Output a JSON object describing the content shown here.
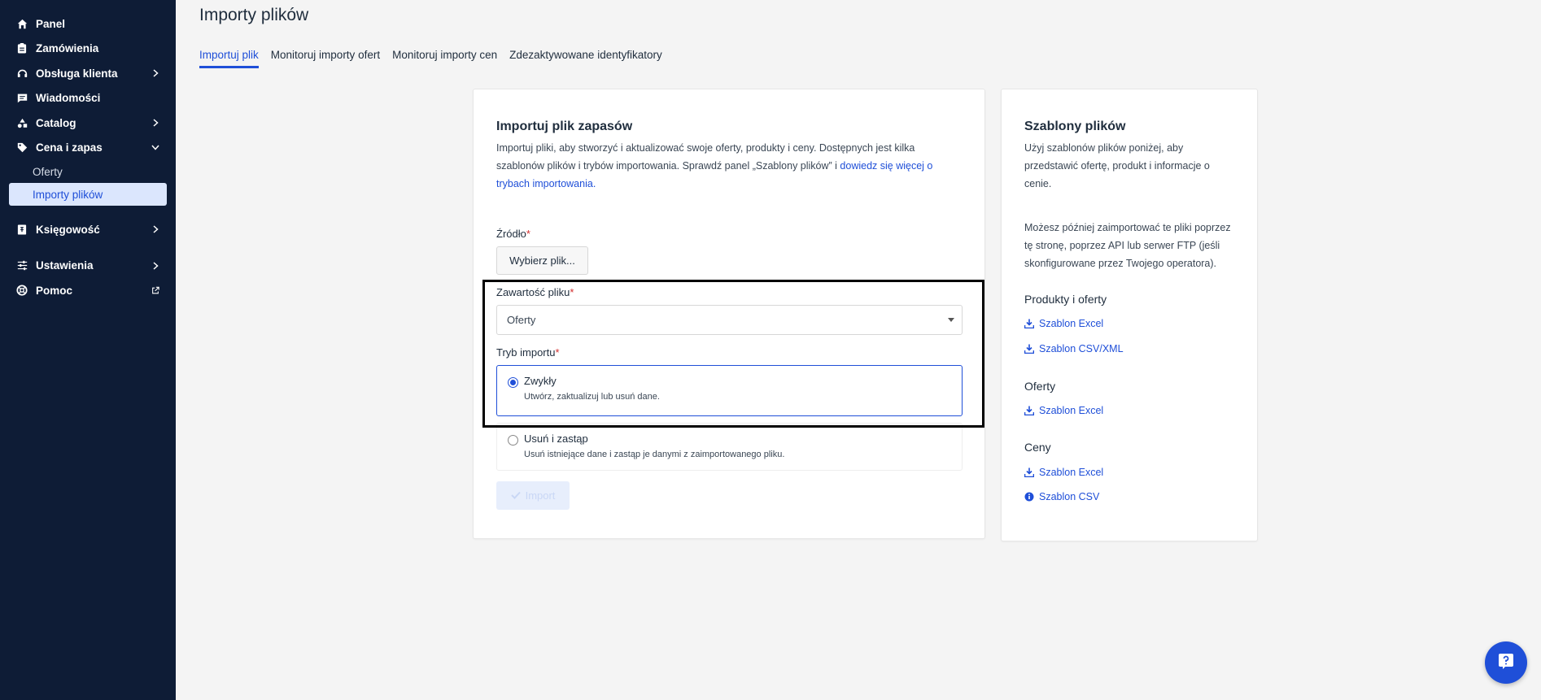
{
  "sidebar": {
    "items": [
      {
        "label": "Panel",
        "icon": "home-icon"
      },
      {
        "label": "Zamówienia",
        "icon": "clipboard-icon"
      },
      {
        "label": "Obsługa klienta",
        "icon": "headset-icon"
      },
      {
        "label": "Wiadomości",
        "icon": "message-icon"
      },
      {
        "label": "Catalog",
        "icon": "shapes-icon"
      },
      {
        "label": "Cena i zapas",
        "icon": "tag-icon"
      },
      {
        "label": "Księgowość",
        "icon": "ledger-icon"
      },
      {
        "label": "Ustawienia",
        "icon": "sliders-icon"
      },
      {
        "label": "Pomoc",
        "icon": "lifebuoy-icon"
      }
    ],
    "subitems": [
      {
        "label": "Oferty"
      },
      {
        "label": "Importy plików"
      }
    ]
  },
  "page": {
    "title": "Importy plików",
    "tabs": [
      {
        "label": "Importuj plik"
      },
      {
        "label": "Monitoruj importy ofert"
      },
      {
        "label": "Monitoruj importy cen"
      },
      {
        "label": "Zdezaktywowane identyfikatory"
      }
    ]
  },
  "form": {
    "title": "Importuj plik zapasów",
    "desc_line1": "Importuj pliki, aby stworzyć i aktualizować swoje oferty, produkty i ceny. Dostępnych jest kilka",
    "desc_line2_text": "szablonów plików i trybów importowania. Sprawdź panel „Szablony plików” i ",
    "desc_line2_link": "dowiedz się więcej o",
    "desc_line3_link": "trybach importowania",
    "desc_line3_end": ".",
    "source_label": "Źródło",
    "required_mark": "*",
    "file_button": "Wybierz plik...",
    "content_label": "Zawartość pliku",
    "content_value": "Oferty",
    "mode_label": "Tryb importu",
    "mode_options": [
      {
        "title": "Zwykły",
        "sub": "Utwórz, zaktualizuj lub usuń dane."
      },
      {
        "title": "Usuń i zastąp",
        "sub": "Usuń istniejące dane i zastąp je danymi z zaimportowanego pliku."
      }
    ],
    "import_button": "Import"
  },
  "templates": {
    "title": "Szablony plików",
    "desc1_line1": "Użyj szablonów plików poniżej, aby",
    "desc1_line2": "przedstawić ofertę, produkt i informacje o",
    "desc1_line3": "cenie.",
    "desc2_line1": "Możesz później zaimportować te pliki poprzez",
    "desc2_line2": "tę stronę, poprzez API lub serwer FTP (jeśli",
    "desc2_line3": "skonfigurowane przez Twojego operatora).",
    "sections": [
      {
        "title": "Produkty i oferty",
        "links": [
          {
            "label": "Szablon Excel",
            "icon": "download-icon"
          },
          {
            "label": "Szablon CSV/XML",
            "icon": "download-icon"
          }
        ]
      },
      {
        "title": "Oferty",
        "links": [
          {
            "label": "Szablon Excel",
            "icon": "download-icon"
          }
        ]
      },
      {
        "title": "Ceny",
        "links": [
          {
            "label": "Szablon Excel",
            "icon": "download-icon"
          },
          {
            "label": "Szablon CSV",
            "icon": "info-icon"
          }
        ]
      }
    ]
  },
  "colors": {
    "sidebar": "#0e1c36",
    "accent": "#1f4fd8",
    "required": "#d32f2f"
  }
}
